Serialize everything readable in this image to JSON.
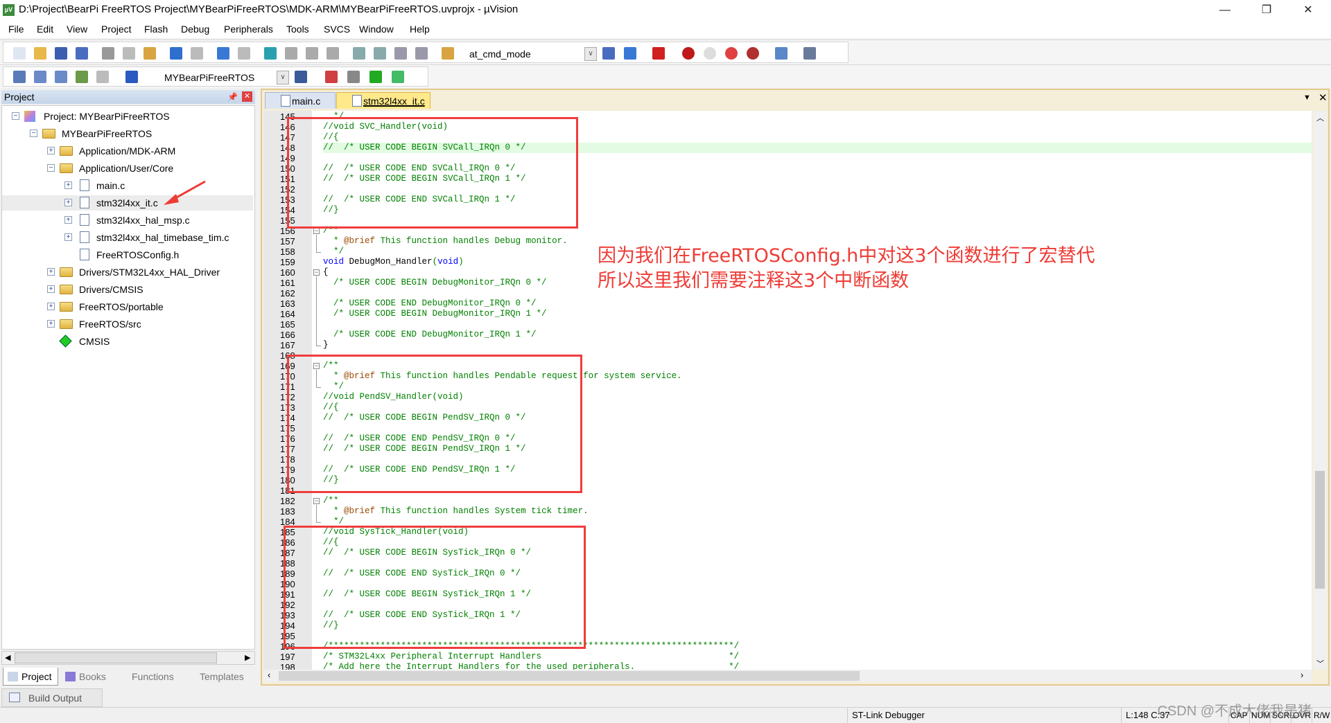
{
  "window": {
    "title": "D:\\Project\\BearPi FreeRTOS Project\\MYBearPiFreeRTOS\\MDK-ARM\\MYBearPiFreeRTOS.uvprojx - µVision",
    "app_icon": "uv",
    "controls": [
      "—",
      "❐",
      "✕"
    ]
  },
  "menu": [
    "File",
    "Edit",
    "View",
    "Project",
    "Flash",
    "Debug",
    "Peripherals",
    "Tools",
    "SVCS",
    "Window",
    "Help"
  ],
  "toolbar1": {
    "target_combo": "at_cmd_mode",
    "icons": [
      "new-file",
      "open",
      "save",
      "save-all",
      "cut",
      "copy",
      "paste",
      "undo",
      "redo",
      "nav-back",
      "nav-forward",
      "bookmark",
      "prev-bookmark",
      "next-bookmark",
      "clear-bookmarks",
      "indent",
      "unindent",
      "comment",
      "uncomment",
      "find-in-files"
    ],
    "icons_right": [
      "find",
      "incremental-find",
      "debug-session",
      "breakpoint",
      "disable-breakpoint",
      "disable-all-breakpoints",
      "kill-breakpoints",
      "window-layout",
      "configure"
    ]
  },
  "toolbar2": {
    "project_combo": "MYBearPiFreeRTOS",
    "icons": [
      "translate",
      "build",
      "rebuild",
      "batch-build",
      "stop-build",
      "download",
      "options",
      "manage-components",
      "select-packs",
      "pack-installer",
      "rte"
    ]
  },
  "project_panel": {
    "title": "Project",
    "tree": [
      {
        "label": "Project: MYBearPiFreeRTOS",
        "level": 0,
        "expander": "−",
        "icon": "project"
      },
      {
        "label": "MYBearPiFreeRTOS",
        "level": 1,
        "expander": "−",
        "icon": "target-folder"
      },
      {
        "label": "Application/MDK-ARM",
        "level": 2,
        "expander": "+",
        "icon": "folder"
      },
      {
        "label": "Application/User/Core",
        "level": 2,
        "expander": "−",
        "icon": "folder-open"
      },
      {
        "label": "main.c",
        "level": 3,
        "expander": "+",
        "icon": "file"
      },
      {
        "label": "stm32l4xx_it.c",
        "level": 3,
        "expander": "+",
        "icon": "file",
        "selected": true
      },
      {
        "label": "stm32l4xx_hal_msp.c",
        "level": 3,
        "expander": "+",
        "icon": "file"
      },
      {
        "label": "stm32l4xx_hal_timebase_tim.c",
        "level": 3,
        "expander": "+",
        "icon": "file"
      },
      {
        "label": "FreeRTOSConfig.h",
        "level": 3,
        "expander": "",
        "icon": "file"
      },
      {
        "label": "Drivers/STM32L4xx_HAL_Driver",
        "level": 2,
        "expander": "+",
        "icon": "folder"
      },
      {
        "label": "Drivers/CMSIS",
        "level": 2,
        "expander": "+",
        "icon": "folder"
      },
      {
        "label": "FreeRTOS/portable",
        "level": 2,
        "expander": "+",
        "icon": "folder"
      },
      {
        "label": "FreeRTOS/src",
        "level": 2,
        "expander": "+",
        "icon": "folder"
      },
      {
        "label": "CMSIS",
        "level": 2,
        "expander": "",
        "icon": "cmsis"
      }
    ],
    "tabs": [
      "Project",
      "Books",
      "Functions",
      "Templates"
    ]
  },
  "editor": {
    "tabs": [
      {
        "label": "main.c",
        "active": false
      },
      {
        "label": "stm32l4xx_it.c",
        "active": true
      }
    ],
    "current_line": 148,
    "lines": [
      {
        "n": 145,
        "t": "  */"
      },
      {
        "n": 146,
        "t": "//void SVC_Handler(void)"
      },
      {
        "n": 147,
        "t": "//{"
      },
      {
        "n": 148,
        "t": "//  /* USER CODE BEGIN SVCall_IRQn 0 */"
      },
      {
        "n": 149,
        "t": ""
      },
      {
        "n": 150,
        "t": "//  /* USER CODE END SVCall_IRQn 0 */"
      },
      {
        "n": 151,
        "t": "//  /* USER CODE BEGIN SVCall_IRQn 1 */"
      },
      {
        "n": 152,
        "t": ""
      },
      {
        "n": 153,
        "t": "//  /* USER CODE END SVCall_IRQn 1 */"
      },
      {
        "n": 154,
        "t": "//}"
      },
      {
        "n": 155,
        "t": ""
      },
      {
        "n": 156,
        "t": "/**",
        "fold": "start"
      },
      {
        "n": 157,
        "t": "  * @brief This function handles Debug monitor."
      },
      {
        "n": 158,
        "t": "  */",
        "fold": "end"
      },
      {
        "n": 159,
        "t": "void DebugMon_Handler(void)",
        "code": true
      },
      {
        "n": 160,
        "t": "{",
        "code": true,
        "fold": "start"
      },
      {
        "n": 161,
        "t": "  /* USER CODE BEGIN DebugMonitor_IRQn 0 */"
      },
      {
        "n": 162,
        "t": ""
      },
      {
        "n": 163,
        "t": "  /* USER CODE END DebugMonitor_IRQn 0 */"
      },
      {
        "n": 164,
        "t": "  /* USER CODE BEGIN DebugMonitor_IRQn 1 */"
      },
      {
        "n": 165,
        "t": ""
      },
      {
        "n": 166,
        "t": "  /* USER CODE END DebugMonitor_IRQn 1 */"
      },
      {
        "n": 167,
        "t": "}",
        "code": true,
        "fold": "end"
      },
      {
        "n": 168,
        "t": ""
      },
      {
        "n": 169,
        "t": "/**",
        "fold": "start"
      },
      {
        "n": 170,
        "t": "  * @brief This function handles Pendable request for system service."
      },
      {
        "n": 171,
        "t": "  */",
        "fold": "end"
      },
      {
        "n": 172,
        "t": "//void PendSV_Handler(void)"
      },
      {
        "n": 173,
        "t": "//{"
      },
      {
        "n": 174,
        "t": "//  /* USER CODE BEGIN PendSV_IRQn 0 */"
      },
      {
        "n": 175,
        "t": ""
      },
      {
        "n": 176,
        "t": "//  /* USER CODE END PendSV_IRQn 0 */"
      },
      {
        "n": 177,
        "t": "//  /* USER CODE BEGIN PendSV_IRQn 1 */"
      },
      {
        "n": 178,
        "t": ""
      },
      {
        "n": 179,
        "t": "//  /* USER CODE END PendSV_IRQn 1 */"
      },
      {
        "n": 180,
        "t": "//}"
      },
      {
        "n": 181,
        "t": ""
      },
      {
        "n": 182,
        "t": "/**",
        "fold": "start"
      },
      {
        "n": 183,
        "t": "  * @brief This function handles System tick timer."
      },
      {
        "n": 184,
        "t": "  */",
        "fold": "end"
      },
      {
        "n": 185,
        "t": "//void SysTick_Handler(void)"
      },
      {
        "n": 186,
        "t": "//{"
      },
      {
        "n": 187,
        "t": "//  /* USER CODE BEGIN SysTick_IRQn 0 */"
      },
      {
        "n": 188,
        "t": ""
      },
      {
        "n": 189,
        "t": "//  /* USER CODE END SysTick_IRQn 0 */"
      },
      {
        "n": 190,
        "t": ""
      },
      {
        "n": 191,
        "t": "//  /* USER CODE BEGIN SysTick_IRQn 1 */"
      },
      {
        "n": 192,
        "t": ""
      },
      {
        "n": 193,
        "t": "//  /* USER CODE END SysTick_IRQn 1 */"
      },
      {
        "n": 194,
        "t": "//}"
      },
      {
        "n": 195,
        "t": ""
      },
      {
        "n": 196,
        "t": "/******************************************************************************/"
      },
      {
        "n": 197,
        "t": "/* STM32L4xx Peripheral Interrupt Handlers                                    */"
      },
      {
        "n": 198,
        "t": "/* Add here the Interrupt Handlers for the used peripherals.                  */"
      }
    ]
  },
  "annotation": {
    "line1": "因为我们在FreeRTOSConfig.h中对这3个函数进行了宏替代",
    "line2": "所以这里我们需要注释这3个中断函数",
    "color": "#ee3b35"
  },
  "build_output": "Build Output",
  "status": {
    "debugger": "ST-Link Debugger",
    "position": "L:148 C:37",
    "flags": [
      "CAP",
      "NUM",
      "SCRL",
      "OVR",
      "R/W"
    ]
  },
  "watermark": "CSDN @不成大佬我是猪",
  "colors": {
    "comment": "#008000",
    "keyword": "#0000ff",
    "doc_tag": "#9a4a00",
    "highlight": "#e2fbe2",
    "active_tab": "#ffe98a",
    "annotation_box": "#f03c3c"
  }
}
